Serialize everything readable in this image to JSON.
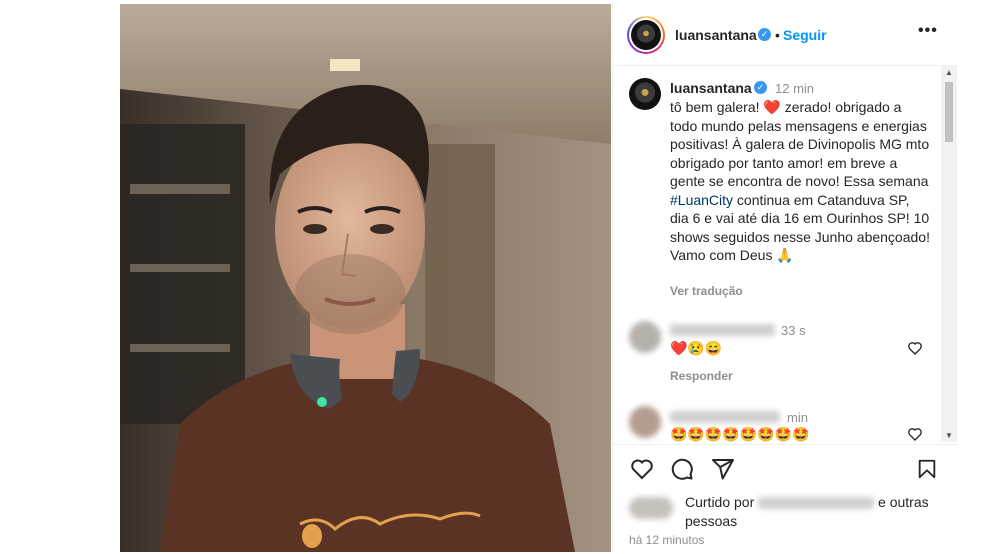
{
  "post": {
    "author": "luansantana",
    "follow_label": "Seguir",
    "more_label": "•••"
  },
  "caption": {
    "author": "luansantana",
    "time": "12 min",
    "text_part1": "tô bem galera! ",
    "heart_emoji": "❤️",
    "text_part2": " zerado! obrigado a todo mundo pelas mensagens e energias positivas! À galera de Divinopolis MG mto obrigado por tanto amor! em breve a gente se encontra de novo! Essa semana ",
    "hashtag": "#LuanCity",
    "text_part3": " continua em Catanduva SP, dia 6 e vai até dia 16 em Ourinhos SP! 10 shows seguidos nesse Junho abençoado! Vamo com Deus ",
    "pray_emoji": "🙏",
    "translate_label": "Ver tradução"
  },
  "comments": [
    {
      "time": "33 s",
      "emojis": "❤️😢😄",
      "reply_label": "Responder"
    },
    {
      "time": "min",
      "emojis": "🤩🤩🤩🤩🤩🤩🤩🤩"
    }
  ],
  "likes": {
    "prefix": "Curtido por",
    "suffix_line1": "e outras",
    "suffix_line2": "pessoas"
  },
  "timestamp": "há 12 minutos",
  "colors": {
    "link_blue": "#0095f6",
    "hashtag_blue": "#00376b",
    "text": "#262626",
    "muted": "#8e8e8e"
  }
}
